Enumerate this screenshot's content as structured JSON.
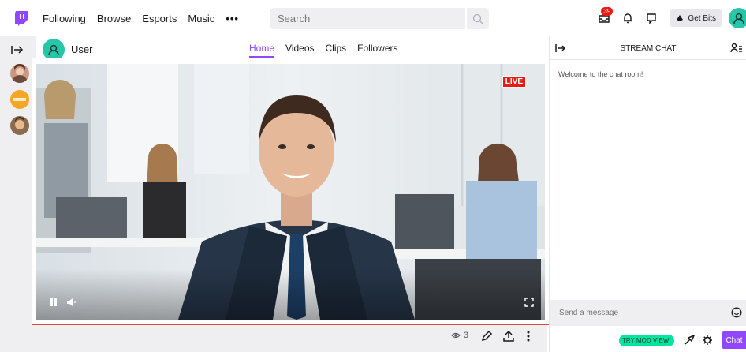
{
  "nav": {
    "links": [
      "Following",
      "Browse",
      "Esports",
      "Music"
    ],
    "more": "•••",
    "search_placeholder": "Search",
    "notification_count": "39",
    "get_bits": "Get Bits"
  },
  "channel": {
    "name": "User",
    "tabs": [
      "Home",
      "Videos",
      "Clips",
      "Followers"
    ],
    "active_tab": "Home"
  },
  "video": {
    "live_label": "LIVE",
    "viewer_count": "3"
  },
  "chat": {
    "title": "STREAM CHAT",
    "welcome": "Welcome to the chat room!",
    "input_placeholder": "Send a message",
    "try_mod_view": "TRY MOD VIEW!",
    "send_label": "Chat"
  },
  "colors": {
    "brand": "#9147ff",
    "live": "#e91916",
    "mod_view": "#00e6a0",
    "avatar": "#26c6a8"
  }
}
